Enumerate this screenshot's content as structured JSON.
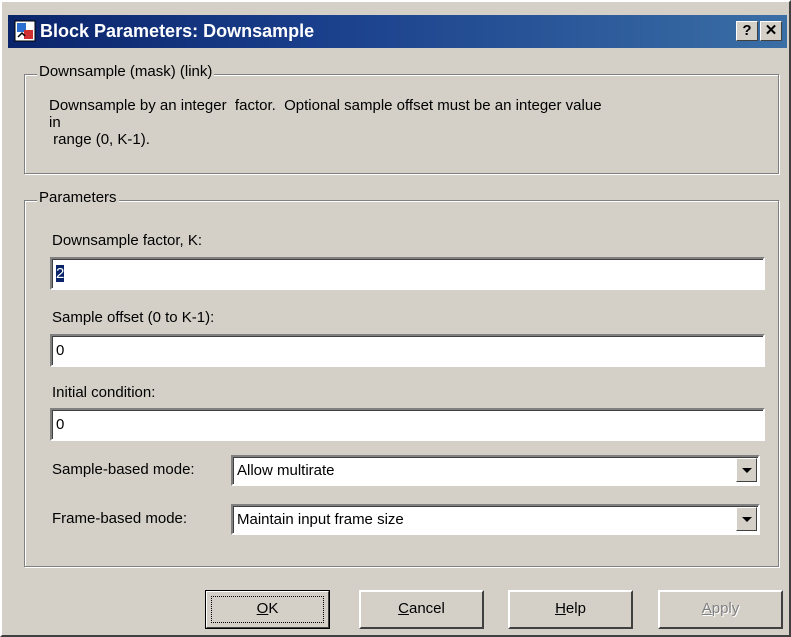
{
  "window": {
    "title": "Block Parameters: Downsample",
    "help_glyph": "?",
    "close_glyph": "✕"
  },
  "description": {
    "legend": "Downsample (mask) (link)",
    "lines": [
      "Downsample by an integer  factor.  Optional sample offset must be an integer value",
      "in",
      " range (0, K-1)."
    ]
  },
  "parameters": {
    "legend": "Parameters",
    "downsample_factor": {
      "label": "Downsample factor, K:",
      "value": "2"
    },
    "sample_offset": {
      "label": "Sample offset (0 to K-1):",
      "value": "0"
    },
    "initial_condition": {
      "label": "Initial condition:",
      "value": "0"
    },
    "sample_based_mode": {
      "label": "Sample-based mode:",
      "value": "Allow multirate"
    },
    "frame_based_mode": {
      "label": "Frame-based mode:",
      "value": "Maintain input frame size"
    }
  },
  "buttons": {
    "ok": {
      "mnemonic": "O",
      "rest": "K"
    },
    "cancel": {
      "mnemonic": "C",
      "rest": "ancel"
    },
    "help": {
      "mnemonic": "H",
      "rest": "elp"
    },
    "apply": {
      "mnemonic": "A",
      "rest": "pply"
    }
  },
  "colors": {
    "titlebar_start": "#0a246a",
    "titlebar_end": "#3a6ea5",
    "face": "#d4d0c8",
    "selection": "#0a246a"
  },
  "icons": {
    "title_icon": "simulink-block-icon",
    "help": "help-question-icon",
    "close": "close-icon",
    "dropdown": "chevron-down-icon"
  }
}
